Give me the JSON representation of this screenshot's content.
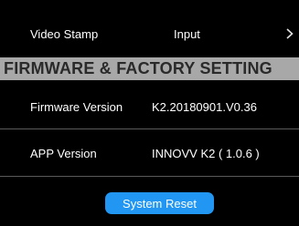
{
  "video_stamp": {
    "label": "Video Stamp",
    "value": "Input"
  },
  "section_header": "FIRMWARE & FACTORY SETTING",
  "firmware": {
    "label": "Firmware  Version",
    "value": "K2.20180901.V0.36"
  },
  "app": {
    "label": "APP Version",
    "value": "INNOVV K2 ( 1.0.6 )"
  },
  "system_reset_label": "System Reset",
  "colors": {
    "background": "#000000",
    "section_bg": "#a8a8a8",
    "button": "#2196f3"
  }
}
